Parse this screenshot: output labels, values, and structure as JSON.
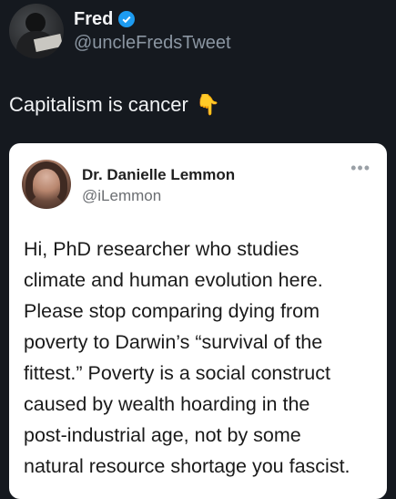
{
  "author": {
    "name": "Fred",
    "handle": "@uncleFredsTweet",
    "verified_icon": "verified-badge-icon",
    "accent": "#1d9bf0"
  },
  "tweet": {
    "text": "Capitalism is cancer",
    "emoji": "👇"
  },
  "quoted": {
    "name": "Dr. Danielle Lemmon",
    "handle": "@iLemmon",
    "menu_icon": "more-options-icon",
    "lines": [
      "Hi, PhD researcher who studies",
      "climate and human evolution here.",
      "Please stop comparing dying from",
      "poverty to Darwin’s “survival of the",
      "fittest.” Poverty is a social construct",
      "caused by wealth hoarding in the",
      "post-industrial age, not by some",
      "natural resource shortage you fascist."
    ]
  }
}
